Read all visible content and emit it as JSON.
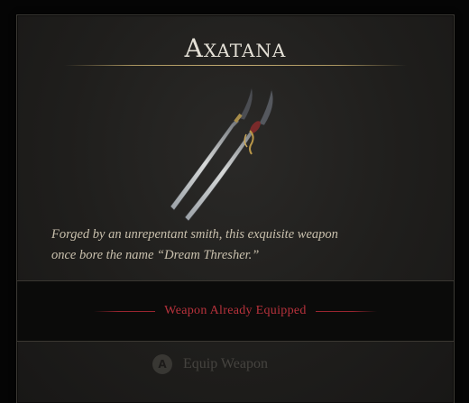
{
  "item": {
    "name": "Axatana",
    "description_line1": "Forged by an unrepentant smith, this exquisite weapon",
    "description_line2": "once bore the name “Dream Thresher.”"
  },
  "status": {
    "text": "Weapon Already Equipped",
    "color": "#b8323c"
  },
  "action": {
    "button_glyph": "A",
    "label": "Equip Weapon",
    "icon": "a-button-icon",
    "enabled": false
  }
}
